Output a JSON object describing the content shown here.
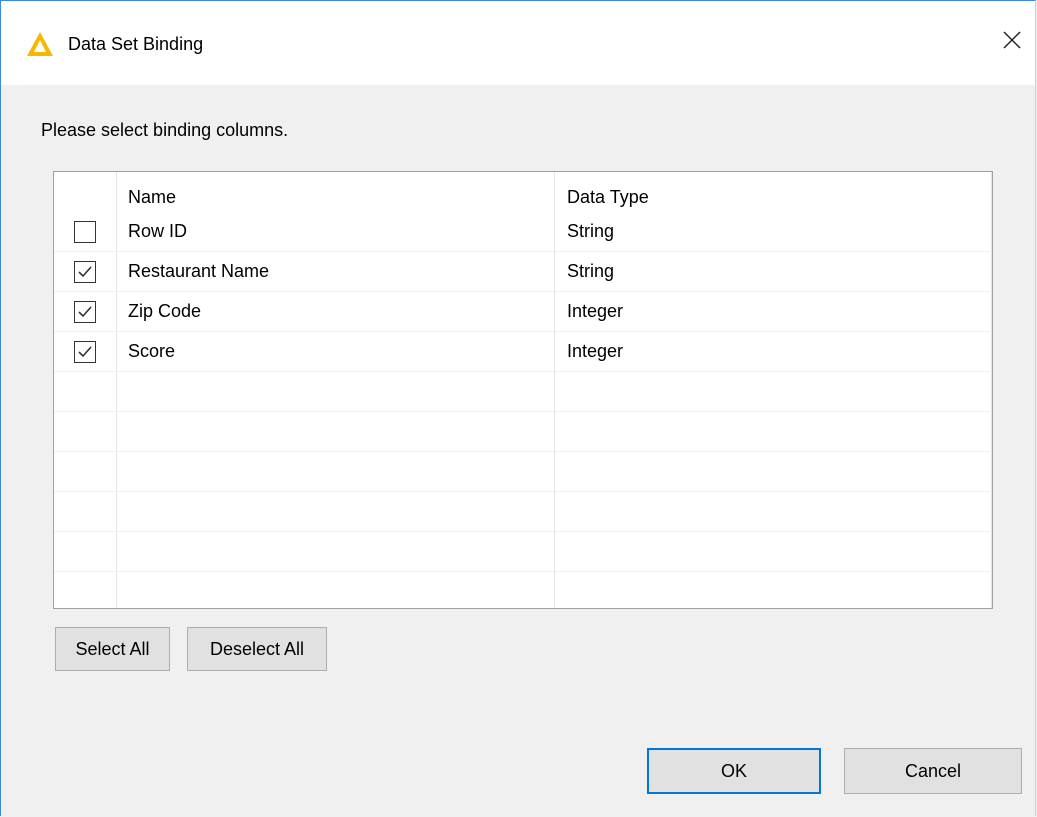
{
  "window": {
    "title": "Data Set Binding"
  },
  "instruction": "Please select binding columns.",
  "table": {
    "headers": {
      "name": "Name",
      "type": "Data Type"
    },
    "rows": [
      {
        "name": "Row ID",
        "type": "String",
        "checked": false
      },
      {
        "name": "Restaurant Name",
        "type": "String",
        "checked": true
      },
      {
        "name": "Zip Code",
        "type": "Integer",
        "checked": true
      },
      {
        "name": "Score",
        "type": "Integer",
        "checked": true
      }
    ],
    "empty_rows": 6
  },
  "buttons": {
    "select_all": "Select All",
    "deselect_all": "Deselect All",
    "ok": "OK",
    "cancel": "Cancel"
  },
  "colors": {
    "accent": "#0078d7",
    "warning_icon": "#f5b800"
  },
  "icons": {
    "title": "warning-triangle-icon",
    "close": "close-icon",
    "checked": "checkmark-icon"
  }
}
